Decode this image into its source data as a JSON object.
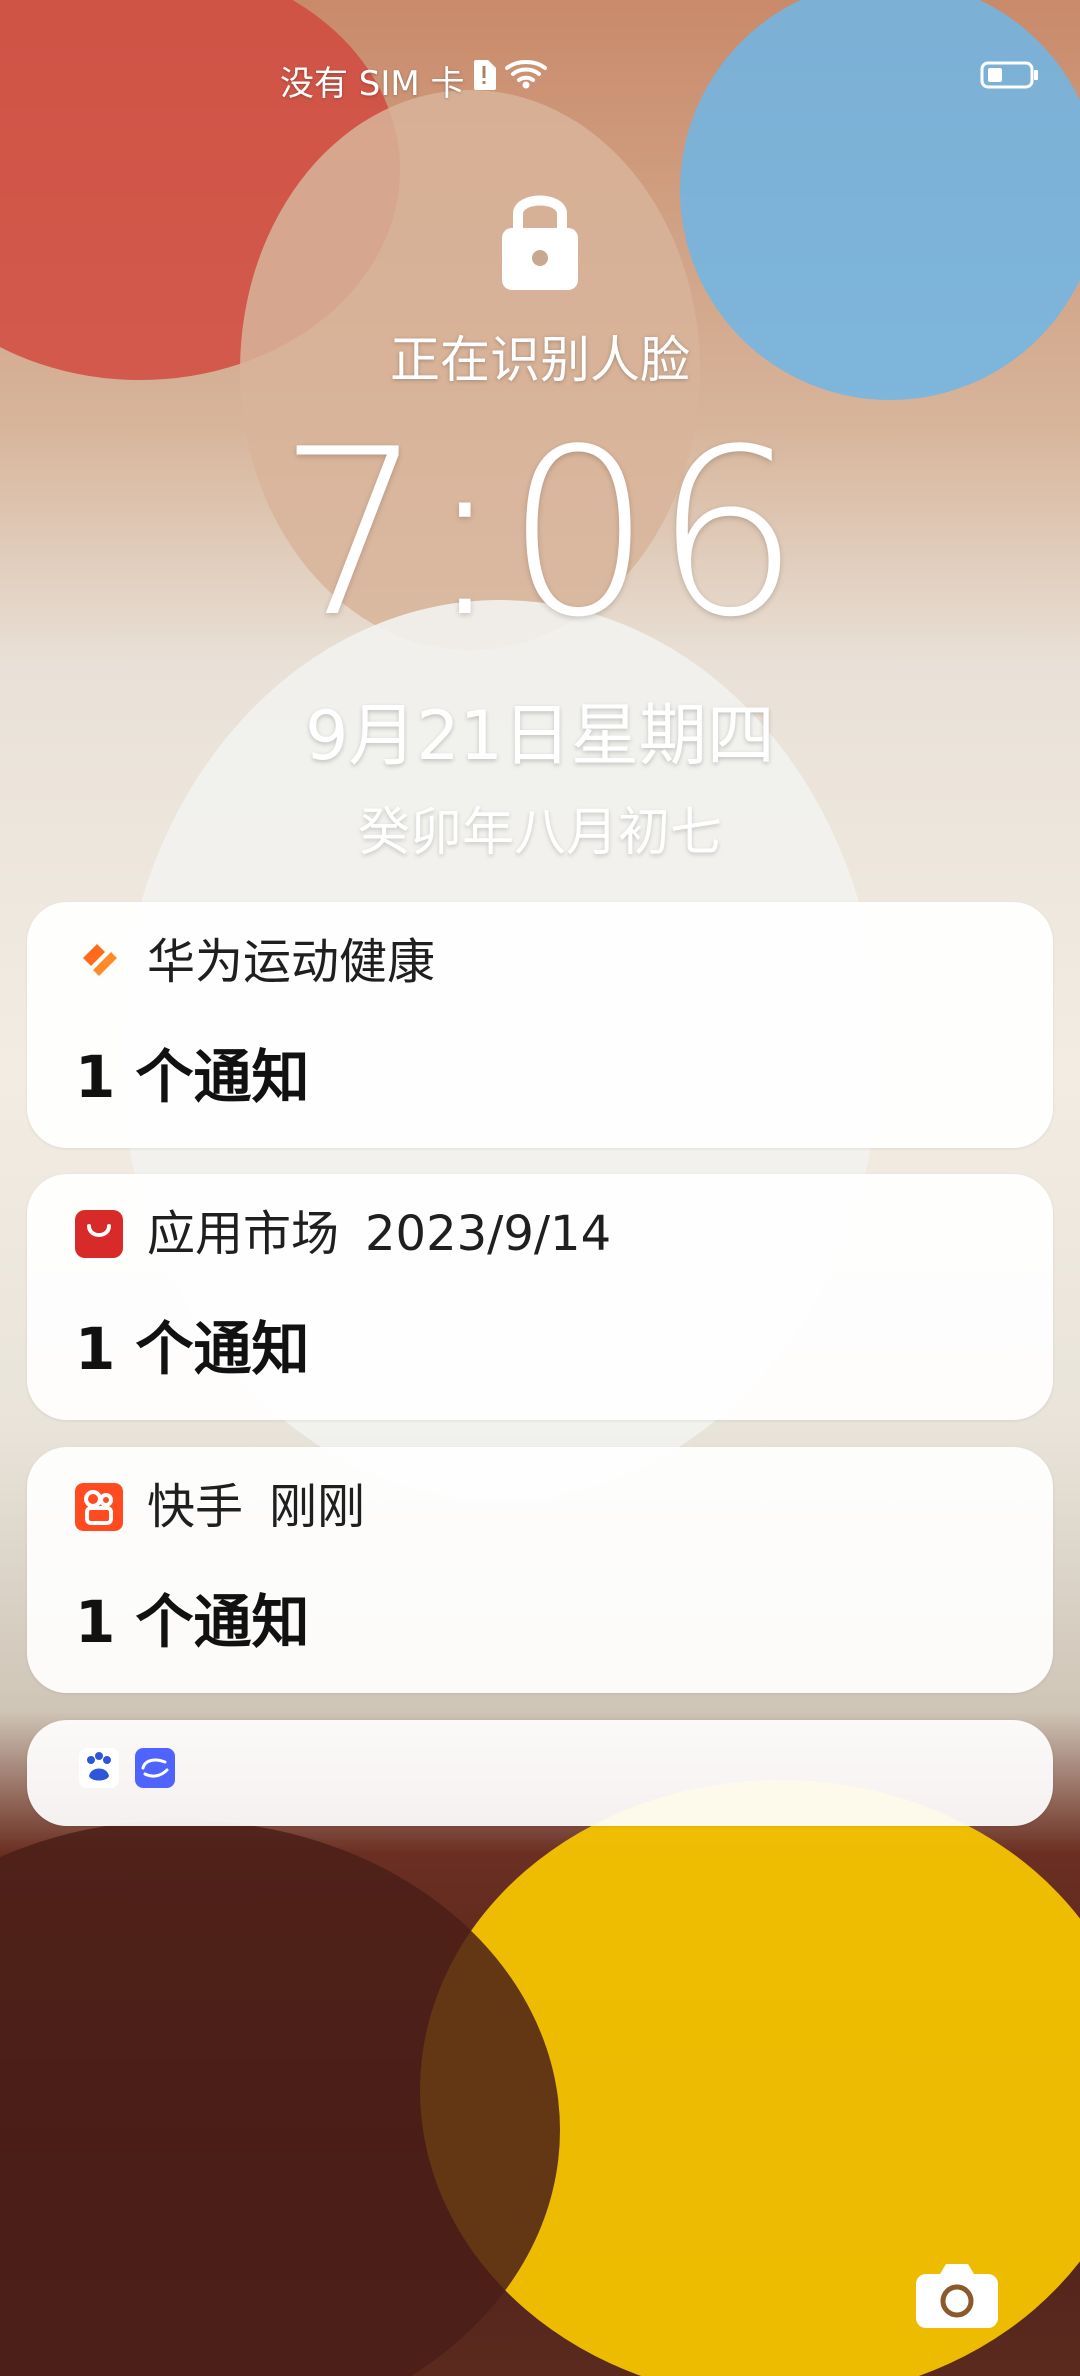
{
  "status_bar": {
    "sim_text": "没有 SIM 卡",
    "icons": [
      "sim-alert-icon",
      "wifi-icon",
      "battery-icon"
    ]
  },
  "lock_screen": {
    "lock_icon": "lock-icon",
    "face_recognition_text": "正在识别人脸",
    "time": "7:06",
    "date": "9月21日星期四",
    "lunar_date": "癸卯年八月初七",
    "camera_icon": "camera-icon"
  },
  "notifications": [
    {
      "app_name": "华为运动健康",
      "time": "",
      "message": "1 个通知",
      "icon": "huawei-health-icon",
      "icon_color": "#ff6b1a"
    },
    {
      "app_name": "应用市场",
      "time": "2023/9/14",
      "message": "1 个通知",
      "icon": "app-market-icon",
      "icon_color": "#d92a2a"
    },
    {
      "app_name": "快手",
      "time": "刚刚",
      "message": "1 个通知",
      "icon": "kuaishou-icon",
      "icon_color": "#ff4b1f"
    }
  ],
  "collapsed_notifications": {
    "icons": [
      "baidu-icon",
      "wechat-like-icon"
    ]
  },
  "colors": {
    "card_bg": "#ffffff",
    "text_primary": "#111111",
    "text_on_wallpaper": "#ffffff"
  }
}
